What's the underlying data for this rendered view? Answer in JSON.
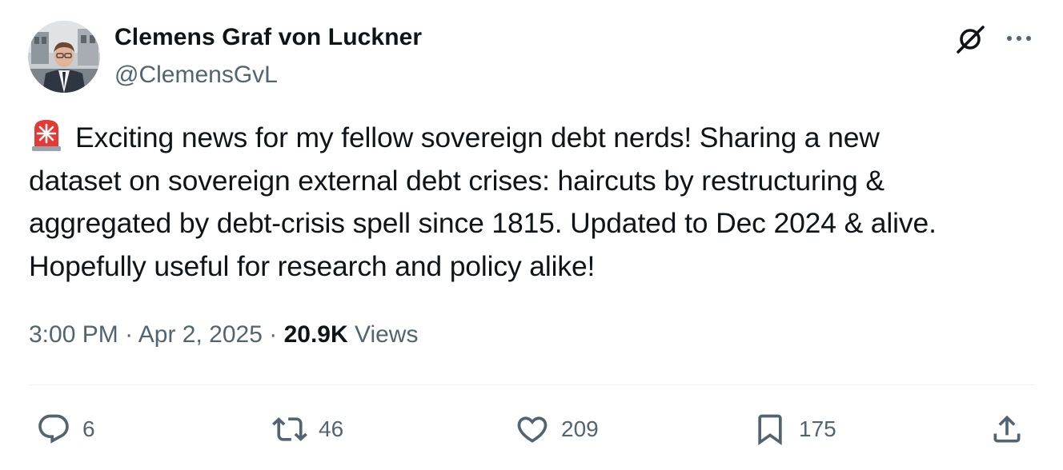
{
  "author": {
    "name": "Clemens Graf von Luckner",
    "handle": "@ClemensGvL"
  },
  "header_icons": [
    "grok-icon",
    "more-icon"
  ],
  "tweet": {
    "lines": [
      "Exciting news for my fellow sovereign debt nerds! Sharing a new",
      "dataset on sovereign external debt crises: haircuts by restructuring &",
      "aggregated by debt-crisis spell since 1815. Updated to Dec 2024 & alive.",
      "Hopefully useful for research and policy alike!"
    ],
    "leading_emoji": "siren-icon"
  },
  "meta": {
    "time": "3:00 PM",
    "separator": "·",
    "date": "Apr 2, 2025",
    "views_count": "20.9K",
    "views_label": "Views"
  },
  "actions": {
    "reply_count": "6",
    "retweet_count": "46",
    "like_count": "209",
    "bookmark_count": "175"
  },
  "colors": {
    "text": "#0f1419",
    "secondary": "#536471",
    "divider": "#eff3f4",
    "siren_red": "#e53935"
  }
}
